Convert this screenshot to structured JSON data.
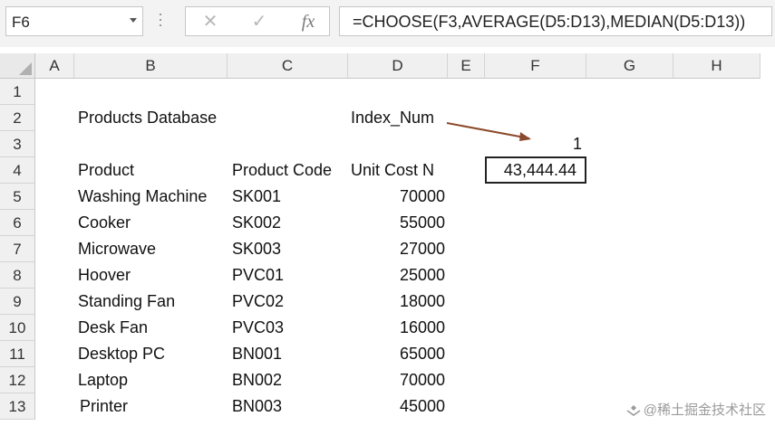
{
  "formula_bar": {
    "name_box": "F6",
    "cancel_icon": "✕",
    "enter_icon": "✓",
    "fx_icon": "fx",
    "formula": "=CHOOSE(F3,AVERAGE(D5:D13),MEDIAN(D5:D13))"
  },
  "columns": [
    "A",
    "B",
    "C",
    "D",
    "E",
    "F",
    "G",
    "H"
  ],
  "rows": [
    "1",
    "2",
    "3",
    "4",
    "5",
    "6",
    "7",
    "8",
    "9",
    "10",
    "11",
    "12",
    "13"
  ],
  "sheet": {
    "title": "Products Database",
    "index_label": "Index_Num",
    "index_value": "1",
    "headers": {
      "product": "Product",
      "code": "Product Code",
      "cost": "Unit Cost N"
    },
    "products": [
      {
        "name": "Washing Machine",
        "code": "SK001",
        "cost": "70000"
      },
      {
        "name": "Cooker",
        "code": "SK002",
        "cost": "55000"
      },
      {
        "name": "Microwave",
        "code": "SK003",
        "cost": "27000"
      },
      {
        "name": "Hoover",
        "code": "PVC01",
        "cost": "25000"
      },
      {
        "name": "Standing Fan",
        "code": "PVC02",
        "cost": "18000"
      },
      {
        "name": "Desk Fan",
        "code": "PVC03",
        "cost": "16000"
      },
      {
        "name": "Desktop PC",
        "code": "BN001",
        "cost": "65000"
      },
      {
        "name": "Laptop",
        "code": "BN002",
        "cost": "70000"
      },
      {
        "name": "Printer",
        "code": "BN003",
        "cost": "45000"
      }
    ],
    "result": "43,444.44"
  },
  "watermark": "@稀土掘金技术社区",
  "colors": {
    "arrow": "#8b4a2b",
    "header_bg": "#f0f0f0",
    "formula_bg": "#f3f3f3"
  }
}
